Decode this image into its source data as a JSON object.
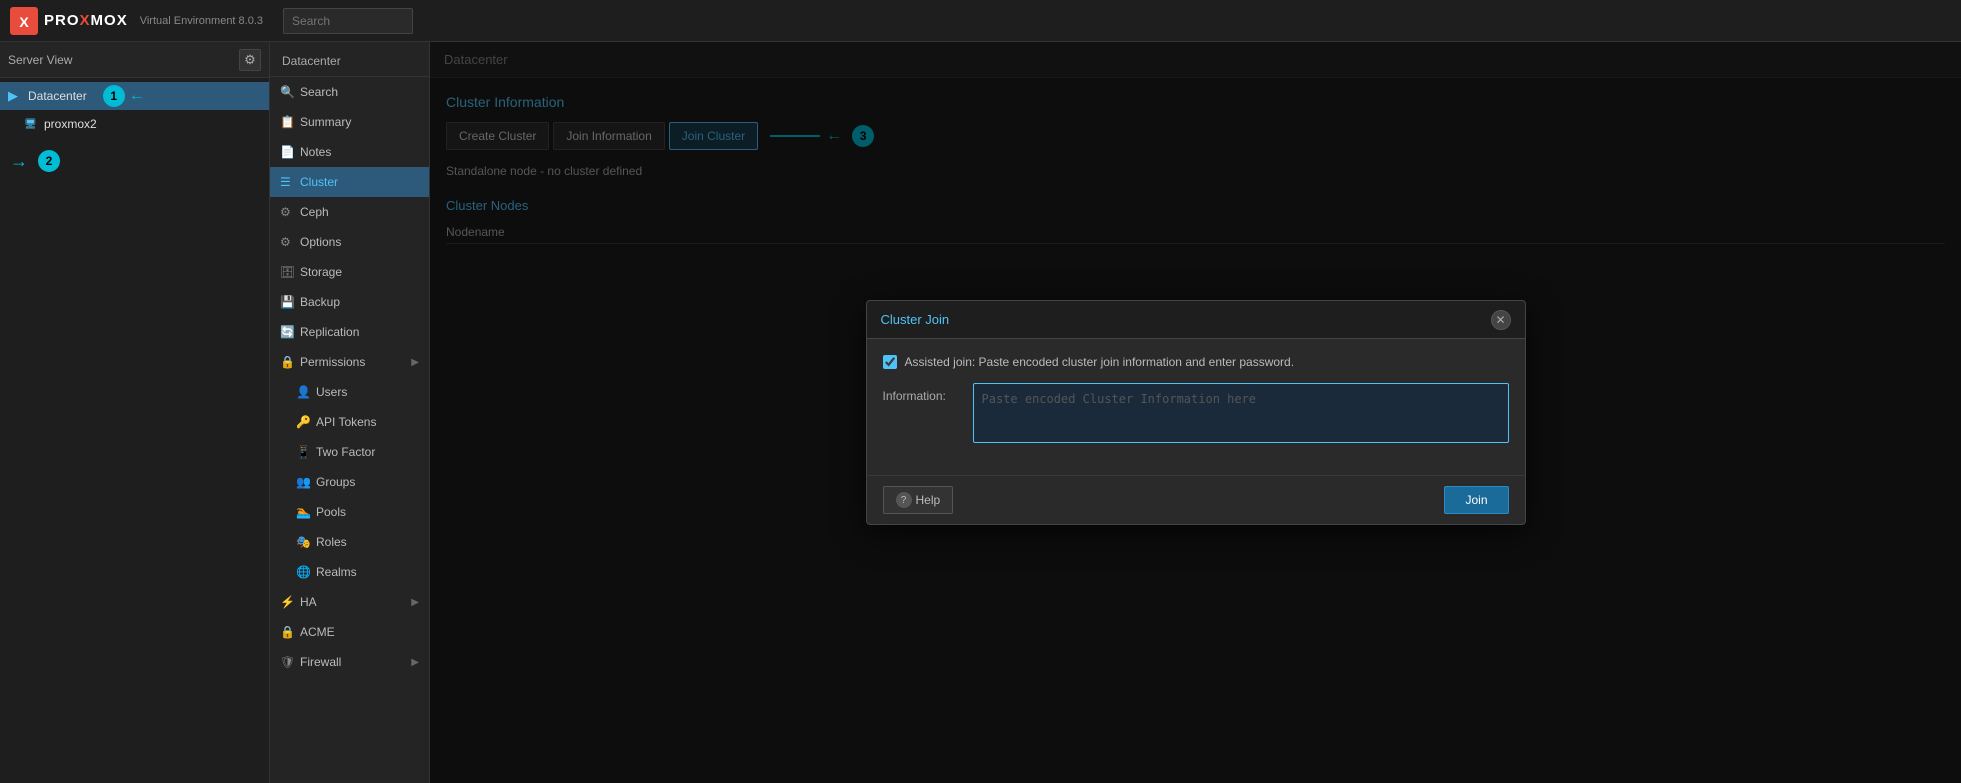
{
  "topbar": {
    "brand_prefix": "PRO",
    "brand_x": "X",
    "brand_suffix": "MOX",
    "product": "Virtual Environment 8.0.3",
    "search_placeholder": "Search"
  },
  "server_view": {
    "label": "Server View",
    "gear_icon": "⚙"
  },
  "tree": {
    "datacenter_label": "Datacenter",
    "node_label": "proxmox2",
    "annotation_1": "1",
    "annotation_2": "2"
  },
  "nav": {
    "header": "Datacenter",
    "items": [
      {
        "id": "search",
        "label": "Search",
        "icon": "🔍"
      },
      {
        "id": "summary",
        "label": "Summary",
        "icon": "📋"
      },
      {
        "id": "notes",
        "label": "Notes",
        "icon": "📝"
      },
      {
        "id": "cluster",
        "label": "Cluster",
        "icon": "☰",
        "active": true
      },
      {
        "id": "ceph",
        "label": "Ceph",
        "icon": "⚙"
      },
      {
        "id": "options",
        "label": "Options",
        "icon": "⚙"
      },
      {
        "id": "storage",
        "label": "Storage",
        "icon": "🗄"
      },
      {
        "id": "backup",
        "label": "Backup",
        "icon": "💾"
      },
      {
        "id": "replication",
        "label": "Replication",
        "icon": "🔄"
      },
      {
        "id": "permissions",
        "label": "Permissions",
        "icon": "🔒",
        "expandable": true
      },
      {
        "id": "users",
        "label": "Users",
        "icon": "👤",
        "sub": true
      },
      {
        "id": "api-tokens",
        "label": "API Tokens",
        "icon": "🔑",
        "sub": true
      },
      {
        "id": "two-factor",
        "label": "Two Factor",
        "icon": "📱",
        "sub": true
      },
      {
        "id": "groups",
        "label": "Groups",
        "icon": "👥",
        "sub": true
      },
      {
        "id": "pools",
        "label": "Pools",
        "icon": "🏊",
        "sub": true
      },
      {
        "id": "roles",
        "label": "Roles",
        "icon": "🎭",
        "sub": true
      },
      {
        "id": "realms",
        "label": "Realms",
        "icon": "🌐",
        "sub": true
      },
      {
        "id": "ha",
        "label": "HA",
        "icon": "⚡",
        "expandable": true
      },
      {
        "id": "acme",
        "label": "ACME",
        "icon": "🔒"
      },
      {
        "id": "firewall",
        "label": "Firewall",
        "icon": "🛡",
        "expandable": true
      }
    ]
  },
  "content": {
    "header": "Datacenter",
    "cluster_info_title": "Cluster Information",
    "buttons": {
      "create_cluster": "Create Cluster",
      "join_information": "Join Information",
      "join_cluster": "Join Cluster"
    },
    "standalone_text": "Standalone node - no cluster defined",
    "cluster_nodes_title": "Cluster Nodes",
    "nodename_header": "Nodename",
    "annotation_3": "3"
  },
  "dialog": {
    "title": "Cluster Join",
    "close_icon": "✕",
    "assisted_join_label": "Assisted join: Paste encoded cluster join information and enter password.",
    "information_label": "Information:",
    "info_placeholder": "Paste encoded Cluster Information here",
    "help_icon": "?",
    "help_label": "Help",
    "join_label": "Join"
  }
}
